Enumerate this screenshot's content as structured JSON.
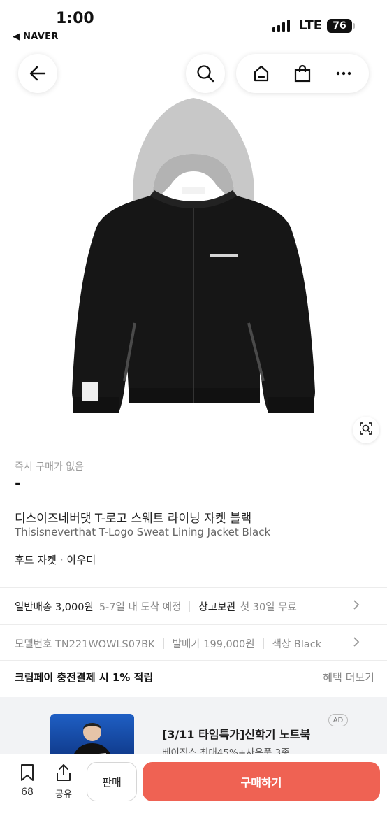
{
  "status_bar": {
    "time": "1:00",
    "back_app": "◀ NAVER",
    "network": "LTE",
    "battery": "76"
  },
  "nav": {
    "icons": [
      "arrow-left-icon",
      "search-icon",
      "home-icon",
      "shopping-bag-icon",
      "more-icon"
    ]
  },
  "product": {
    "instant_buy_label": "즉시 구매가 없음",
    "price": "-",
    "title_ko": "디스이즈네버댓 T-로고 스웨트 라이닝 자켓 블랙",
    "title_en": "Thisisneverthat T-Logo Sweat Lining Jacket Black",
    "category_1": "후드 자켓",
    "category_sep": "·",
    "category_2": "아우터"
  },
  "shipping": {
    "label": "일반배송 3,000원",
    "eta": "5-7일 내 도착 예정",
    "storage_label": "창고보관",
    "storage_note": "첫 30일 무료"
  },
  "specs": {
    "model": "모델번호 TN221WOWLS07BK",
    "release_price": "발매가 199,000원",
    "color": "색상 Black"
  },
  "benefit": {
    "text": "크림페이 충전결제 시 1% 적립",
    "more": "혜택 더보기"
  },
  "ad": {
    "title": "[3/11 타임특가]신학기 노트북",
    "subtitle": "베이직스 최대45%+사은품 3종",
    "badge": "AD"
  },
  "bottom_bar": {
    "bookmark_count": "68",
    "share_label": "공유",
    "sell_label": "판매",
    "buy_label": "구매하기"
  },
  "colors": {
    "buy_button": "#ef6253",
    "jacket_body": "#161616",
    "hood": "#c9c9c9"
  }
}
